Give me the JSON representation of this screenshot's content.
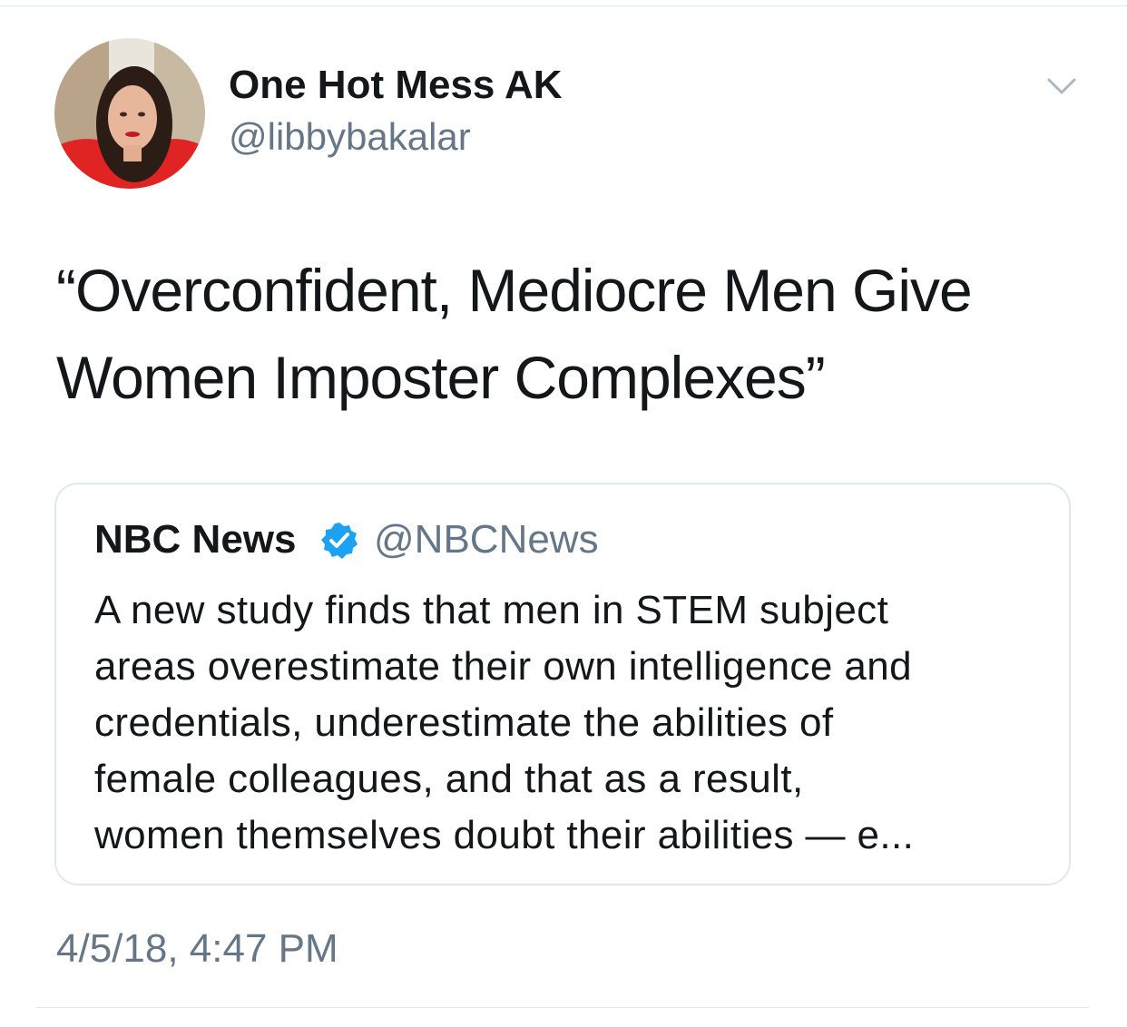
{
  "author": {
    "display_name": "One Hot Mess AK",
    "handle": "@libbybakalar",
    "avatar_icon": "profile-photo"
  },
  "tweet": {
    "lines": [
      "“Overconfident, Mediocre Men Give",
      "Women Imposter Complexes”"
    ],
    "timestamp": "4/5/18, 4:47 PM",
    "menu_icon": "chevron-down-icon"
  },
  "quoted_tweet": {
    "display_name": "NBC News",
    "verified": true,
    "verified_icon": "verified-badge-icon",
    "handle": "@NBCNews",
    "lines": [
      "A new study finds that men in STEM subject",
      "areas overestimate their own intelligence and",
      "credentials, underestimate the abilities of",
      "female colleagues, and that as a result,",
      "women themselves doubt their abilities — e..."
    ]
  },
  "colors": {
    "text_primary": "#14171a",
    "text_secondary": "#657786",
    "border": "#e1e8ed",
    "verified_blue": "#1da1f2"
  }
}
